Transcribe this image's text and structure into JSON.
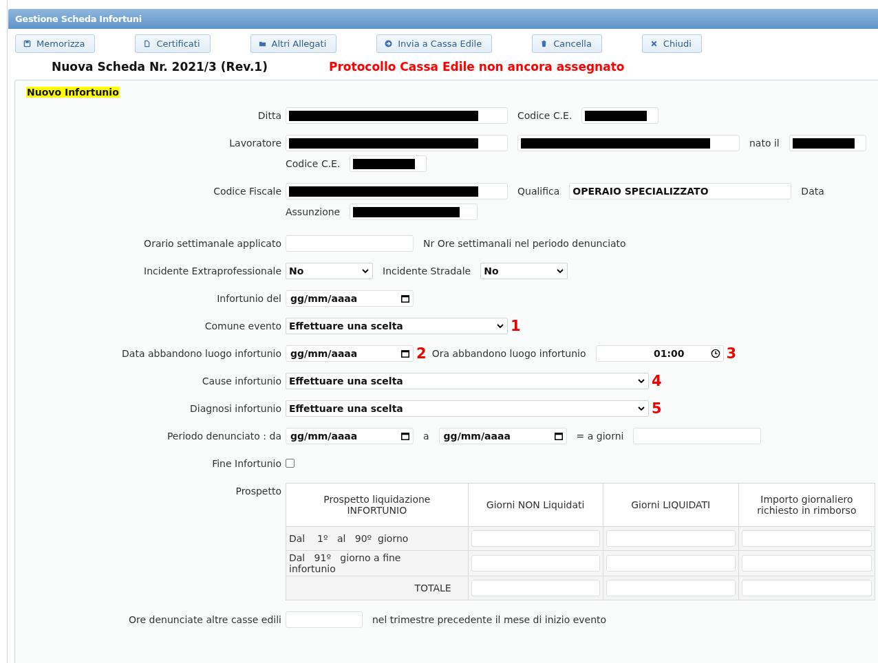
{
  "window": {
    "title": "Gestione Scheda Infortuni"
  },
  "toolbar": [
    {
      "label": "Memorizza"
    },
    {
      "label": "Certificati"
    },
    {
      "label": "Altri Allegati"
    },
    {
      "label": "Invia a Cassa Edile"
    },
    {
      "label": "Cancella"
    },
    {
      "label": "Chiudi"
    }
  ],
  "heading": {
    "title": "Nuova Scheda Nr. 2021/3 (Rev.1)",
    "protocol": "Protocollo Cassa Edile non ancora assegnato"
  },
  "section": {
    "title": "Nuovo Infortunio"
  },
  "rows": [
    {
      "label": "Ditta",
      "items": [
        {
          "kind": "longfield",
          "redacted": true
        },
        {
          "kind": "text",
          "text": "Codice C.E."
        },
        {
          "kind": "shortfield",
          "redacted": true
        }
      ]
    },
    {
      "label": "Lavoratore",
      "items": [
        {
          "kind": "longfield",
          "redacted": true
        },
        {
          "kind": "longfield",
          "redacted": true
        },
        {
          "kind": "text",
          "text": "nato il"
        },
        {
          "kind": "shortfield",
          "redacted": true
        },
        {
          "kind": "break"
        },
        {
          "kind": "text",
          "text": "Codice C.E."
        },
        {
          "kind": "shortfield",
          "redacted": true
        }
      ]
    },
    {
      "label": "Codice Fiscale",
      "items": [
        {
          "kind": "longfield",
          "redacted": true
        },
        {
          "kind": "text",
          "text": "Qualifica"
        },
        {
          "kind": "longfield",
          "value": "OPERAIO SPECIALIZZATO"
        },
        {
          "kind": "text",
          "text": "Data"
        },
        {
          "kind": "break"
        },
        {
          "kind": "text",
          "text": "Assunzione"
        },
        {
          "kind": "field",
          "redacted": true
        }
      ]
    },
    {
      "label": "Orario settimanale applicato",
      "items": [
        {
          "kind": "field"
        },
        {
          "kind": "text",
          "text": "Nr Ore settimanali nel periodo denunciato"
        }
      ]
    },
    {
      "label": "Incidente Extraprofessionale",
      "items": [
        {
          "kind": "shortselect",
          "value": "No"
        },
        {
          "kind": "text",
          "text": "Incidente Stradale"
        },
        {
          "kind": "shortselect",
          "value": "No"
        }
      ]
    },
    {
      "label": "Infortunio del",
      "items": [
        {
          "kind": "date",
          "format": "gg/mm/aaaa"
        }
      ]
    },
    {
      "label": "Comune evento",
      "items": [
        {
          "kind": "select",
          "value": "Effettuare una scelta"
        },
        {
          "kind": "marker",
          "text": "1"
        }
      ]
    },
    {
      "label": "Data abbandono luogo infortunio",
      "items": [
        {
          "kind": "date",
          "format": "gg/mm/aaaa"
        },
        {
          "kind": "marker",
          "text": "2"
        },
        {
          "kind": "text",
          "text": "Ora abbandono luogo infortunio"
        },
        {
          "kind": "time",
          "value": "01:00"
        },
        {
          "kind": "marker",
          "text": "3"
        }
      ]
    },
    {
      "label": "Cause infortunio",
      "items": [
        {
          "kind": "longselect",
          "value": "Effettuare una scelta"
        },
        {
          "kind": "marker",
          "text": "4"
        }
      ]
    },
    {
      "label": "Diagnosi infortunio",
      "items": [
        {
          "kind": "longselect",
          "value": "Effettuare una scelta"
        },
        {
          "kind": "marker",
          "text": "5"
        }
      ]
    },
    {
      "label": "Periodo denunciato : da",
      "items": [
        {
          "kind": "date",
          "format": "gg/mm/aaaa"
        },
        {
          "kind": "text",
          "text": "a"
        },
        {
          "kind": "date",
          "format": "gg/mm/aaaa"
        },
        {
          "kind": "text",
          "text": "= a giorni"
        },
        {
          "kind": "field"
        }
      ]
    },
    {
      "label": "Fine Infortunio",
      "items": [
        {
          "kind": "checkbox",
          "checked": false
        }
      ]
    }
  ],
  "prospetto": {
    "label": "Prospetto",
    "columns": [
      "Prospetto liquidazione INFORTUNIO",
      "Giorni NON Liquidati",
      "Giorni LIQUIDATI",
      "Importo giornaliero richiesto in rimborso"
    ],
    "rows": [
      {
        "label": "Dal    1º   al   90º  giorno",
        "kind": "period"
      },
      {
        "label": "Dal   91º   giorno a fine infortunio",
        "kind": "period"
      },
      {
        "label": "TOTALE",
        "kind": "total"
      }
    ]
  },
  "footer_row": {
    "label": "Ore denunciate altre casse edili",
    "items": [
      {
        "kind": "shortfield"
      },
      {
        "kind": "text",
        "text": "nel trimestre precedente il mese di inizio evento"
      }
    ]
  }
}
